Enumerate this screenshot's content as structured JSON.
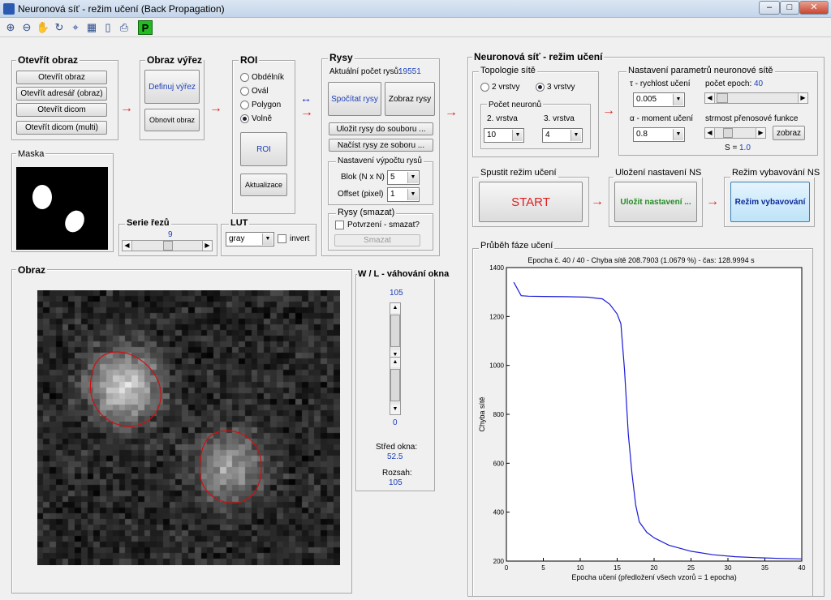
{
  "window": {
    "title": "Neuronová síť - režim učení (Back Propagation)",
    "minimize": "–",
    "maximize": "□",
    "close": "✕"
  },
  "toolbar": {
    "p_label": "P"
  },
  "open_image": {
    "title": "Otevřít obraz",
    "btn_open": "Otevřít obraz",
    "btn_open_dir": "Otevřít adresář (obraz)",
    "btn_dicom": "Otevřít dicom",
    "btn_dicom_multi": "Otevřít dicom (multi)"
  },
  "crop": {
    "title": "Obraz výřez",
    "btn_define": "Definuj výřez",
    "btn_restore": "Obnovit obraz"
  },
  "roi": {
    "title": "ROI",
    "options": [
      "Obdélník",
      "Ovál",
      "Polygon",
      "Volně"
    ],
    "selected": "Volně",
    "btn_roi": "ROI",
    "btn_update": "Aktualizace"
  },
  "features": {
    "title": "Rysy",
    "count_label": "Aktuální počet rysů:",
    "count_value": "19551",
    "btn_compute": "Spočítat rysy",
    "btn_show": "Zobraz rysy",
    "btn_save": "Uložit rysy do souboru ...",
    "btn_load": "Načíst rysy ze soboru ...",
    "calc_title": "Nastavení výpočtu rysů",
    "block_label": "Blok (N x N)",
    "block_value": "5",
    "offset_label": "Offset (pixel)",
    "offset_value": "1",
    "del_title": "Rysy (smazat)",
    "confirm_label": "Potvrzení - smazat?",
    "btn_delete": "Smazat"
  },
  "mask": {
    "title": "Maska"
  },
  "series": {
    "title": "Serie řezů",
    "value": "9"
  },
  "lut": {
    "title": "LUT",
    "value": "gray",
    "invert_label": "invert"
  },
  "image": {
    "title": "Obraz"
  },
  "wl": {
    "title": "W / L - váhování okna",
    "top_value": "105",
    "bottom_value": "0",
    "center_label": "Střed okna:",
    "center_value": "52.5",
    "range_label": "Rozsah:",
    "range_value": "105"
  },
  "nn": {
    "title": "Neuronová síť - režim učení",
    "topology": {
      "title": "Topologie sítě",
      "opt2": "2 vrstvy",
      "opt3": "3 vrstvy",
      "selected": "3 vrstvy",
      "neurons_label": "Počet neuronů",
      "layer2_label": "2. vrstva",
      "layer2_value": "10",
      "layer3_label": "3. vrstva",
      "layer3_value": "4"
    },
    "params": {
      "title": "Nastavení parametrů neuronové sítě",
      "lr_label": "τ  - rychlost učení",
      "lr_value": "0.005",
      "epochs_label": "počet epoch:",
      "epochs_value": "40",
      "mom_label": "α  - moment učení",
      "mom_value": "0.8",
      "slope_label": "strmost přenosové funkce",
      "btn_show": "zobraz",
      "s_label": "S =",
      "s_value": "1.0"
    },
    "start": {
      "title": "Spustit režim učení",
      "btn": "START"
    },
    "save": {
      "title": "Uložení nastavení NS",
      "btn": "Uložit nastavení ..."
    },
    "classify": {
      "title": "Režim vybavování NS",
      "btn": "Režim vybavování"
    },
    "progress": {
      "title": "Průběh fáze učení"
    }
  },
  "colors": {
    "start": "#e02020",
    "save": "#228b22",
    "classify_text": "#0a2a9a",
    "curve": "#1a1ad8",
    "roi": "#d01010"
  },
  "chart_data": {
    "type": "line",
    "title": "Epocha č. 40 / 40 - Chyba sítě 208.7903 (1.0679 %) - čas: 128.9994 s",
    "xlabel": "Epocha učení (předložení všech vzorů = 1 epocha)",
    "ylabel": "Chyba sítě",
    "xlim": [
      0,
      40
    ],
    "ylim": [
      200,
      1400
    ],
    "xticks": [
      0,
      5,
      10,
      15,
      20,
      25,
      30,
      35,
      40
    ],
    "yticks": [
      200,
      400,
      600,
      800,
      1000,
      1200,
      1400
    ],
    "grid": false,
    "series": [
      {
        "x": [
          1,
          2,
          3,
          5,
          8,
          11,
          13,
          14,
          15,
          15.5,
          16,
          16.5,
          17,
          17.5,
          18,
          19,
          20,
          22,
          25,
          28,
          31,
          34,
          37,
          40
        ],
        "values": [
          1340,
          1285,
          1283,
          1282,
          1281,
          1279,
          1272,
          1250,
          1210,
          1170,
          980,
          720,
          560,
          430,
          360,
          318,
          295,
          265,
          240,
          226,
          218,
          214,
          211,
          209
        ]
      }
    ]
  }
}
